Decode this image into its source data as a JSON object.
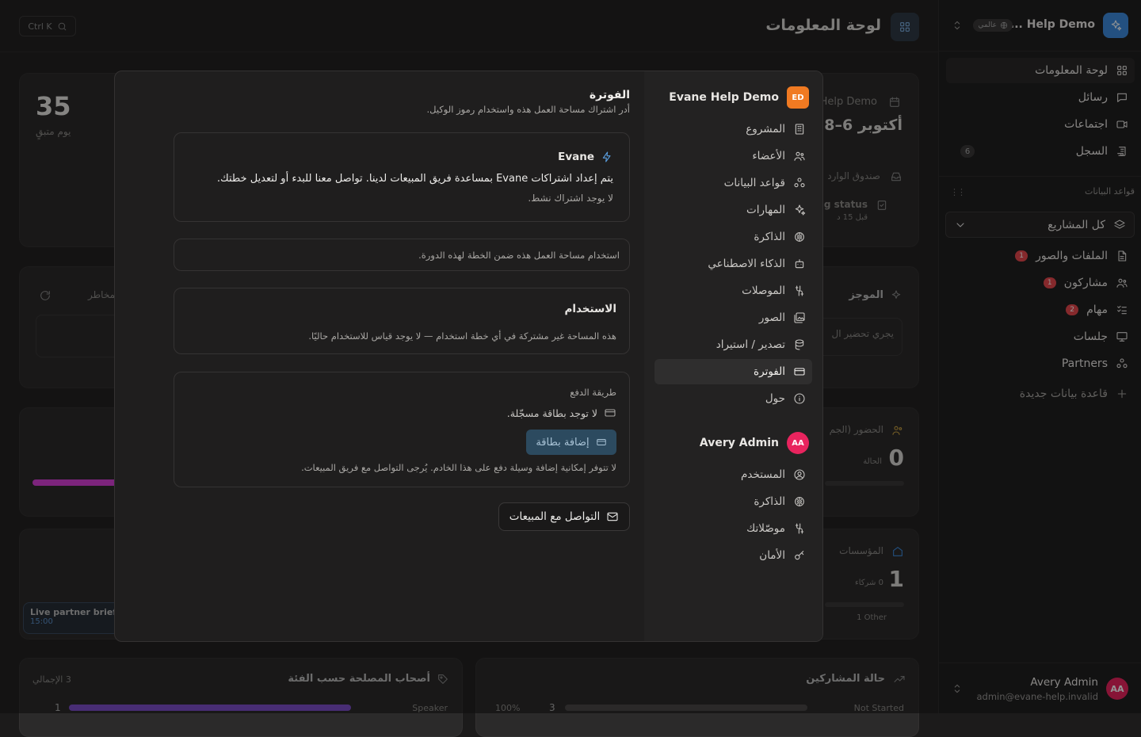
{
  "workspace": {
    "name": "Help Demo ...",
    "scope_badge": "عالمي"
  },
  "sidebar": {
    "nav": [
      {
        "label": "لوحة المعلومات",
        "icon": "dashboard-icon",
        "active": true
      },
      {
        "label": "رسائل",
        "icon": "message-icon"
      },
      {
        "label": "اجتماعات",
        "icon": "video-icon"
      },
      {
        "label": "السجل",
        "icon": "log-icon",
        "count": "6"
      }
    ],
    "databases_label": "قواعد البيانات",
    "project_selector": "كل المشاريع",
    "databases": [
      {
        "label": "الملفات والصور",
        "icon": "file-icon",
        "count": "1"
      },
      {
        "label": "مشاركون",
        "icon": "users-icon",
        "count": "1"
      },
      {
        "label": "مهام",
        "icon": "tasks-icon",
        "count": "2"
      },
      {
        "label": "جلسات",
        "icon": "presentation-icon"
      },
      {
        "label": "Partners",
        "icon": "partners-icon"
      }
    ],
    "new_database": "قاعدة بيانات جديدة",
    "user": {
      "name": "Avery Admin",
      "email": "admin@evane-help.invalid",
      "initials": "AA"
    }
  },
  "main": {
    "page_title": "لوحة المعلومات",
    "search_hint": "Ctrl K",
    "stat_days": "35",
    "stat_days_label": "يوم متبقٍ",
    "date_card_org": "Help Demo",
    "date_card_value": "أكتوبر 6–8",
    "inbox_label": "صندوق الوارد",
    "status_label": "g status",
    "status_time": "قبل 15 د",
    "risks_label": "المخاطر",
    "summary_label": "الموجز",
    "summary_text": "يجري تحضير ال",
    "attendance_label": "الحضور (الجم",
    "attendance_value": "0",
    "attendance_sub": "الحالة",
    "orgs_label": "المؤسسات",
    "orgs_value": "1",
    "orgs_sub": "0 شركاء",
    "orgs_other": "1 Other",
    "live_brief": "Live partner briefi",
    "live_time": "15:00",
    "stakeholders_title": "أصحاب المصلحة حسب الفئة",
    "stakeholders_total": "3 الإجمالي",
    "stakeholder_row": {
      "label": "Speaker",
      "value": "1"
    },
    "participants_title": "حالة المشاركين",
    "participants_row": {
      "label": "Not Started",
      "value": "3",
      "pct": "100%"
    }
  },
  "dialog": {
    "nav_org": {
      "name": "Evane Help Demo",
      "initials": "ED"
    },
    "org_items": [
      {
        "label": "المشروع",
        "icon": "building-icon"
      },
      {
        "label": "الأعضاء",
        "icon": "members-icon"
      },
      {
        "label": "قواعد البيانات",
        "icon": "databases-icon"
      },
      {
        "label": "المهارات",
        "icon": "sparkles-icon"
      },
      {
        "label": "الذاكرة",
        "icon": "brain-icon"
      },
      {
        "label": "الذكاء الاصطناعي",
        "icon": "bot-icon"
      },
      {
        "label": "الموصلات",
        "icon": "connectors-icon"
      },
      {
        "label": "الصور",
        "icon": "images-icon"
      },
      {
        "label": "تصدير / استيراد",
        "icon": "export-icon"
      },
      {
        "label": "الفوترة",
        "icon": "card-icon",
        "active": true
      },
      {
        "label": "حول",
        "icon": "info-icon"
      }
    ],
    "nav_user": {
      "name": "Avery Admin",
      "initials": "AA"
    },
    "user_items": [
      {
        "label": "المستخدم",
        "icon": "user-circle-icon"
      },
      {
        "label": "الذاكرة",
        "icon": "brain-icon"
      },
      {
        "label": "موصّلاتك",
        "icon": "connectors-icon"
      },
      {
        "label": "الأمان",
        "icon": "key-icon"
      }
    ],
    "title": "الفوترة",
    "subtitle": "أدر اشتراك مساحة العمل هذه واستخدام رموز الوكيل.",
    "plan": {
      "name": "Evane",
      "message": "يتم إعداد اشتراكات Evane بمساعدة فريق المبيعات لدينا. تواصل معنا للبدء أو لتعديل خطتك.",
      "status": "لا يوجد اشتراك نشط."
    },
    "plan_usage_text": "استخدام مساحة العمل هذه ضمن الخطة لهذه الدورة.",
    "usage": {
      "title": "الاستخدام",
      "text": "هذه المساحة غير مشتركة في أي خطة استخدام — لا يوجد قياس للاستخدام حاليًا."
    },
    "payment": {
      "title": "طريقة الدفع",
      "no_card": "لا توجد بطاقة مسجّلة.",
      "add_card": "إضافة بطاقة",
      "note": "لا تتوفر إمكانية إضافة وسيلة دفع على هذا الخادم. يُرجى التواصل مع فريق المبيعات."
    },
    "contact_sales": "التواصل مع المبيعات"
  },
  "colors": {
    "accent_blue": "#3d8bdc",
    "badge_red": "#e5484d",
    "avatar_pink": "#e8245e",
    "org_orange": "#f07a22"
  }
}
